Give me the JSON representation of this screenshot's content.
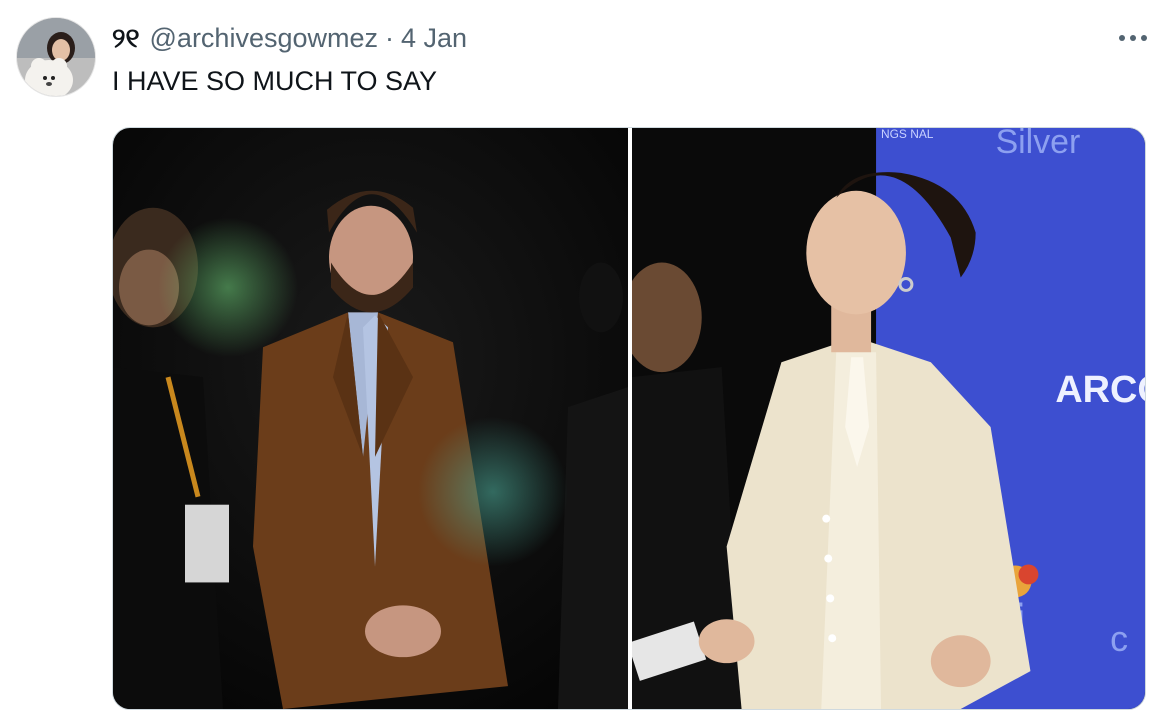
{
  "tweet": {
    "display_name": "୨୧",
    "handle": "@archivesgowmez",
    "separator": "·",
    "date": "4 Jan",
    "text": "I HAVE SO MUCH TO SAY",
    "more_icon": "more-horizontal-icon"
  },
  "media": [
    {
      "kind": "photo",
      "description_icon": "photo-man-brown-suit"
    },
    {
      "kind": "photo",
      "description_icon": "photo-woman-white-suit",
      "backdrop_text_top": "Silver",
      "backdrop_text_mid": "ARCO",
      "backdrop_text_small": "NGS\nNAL",
      "backdrop_text_bottom": "Si",
      "backdrop_text_bottom_right": "c"
    }
  ],
  "colors": {
    "text_primary": "#0f1419",
    "text_secondary": "#536471",
    "backdrop_blue": "#3d4fd0",
    "border": "#cfd9de"
  }
}
